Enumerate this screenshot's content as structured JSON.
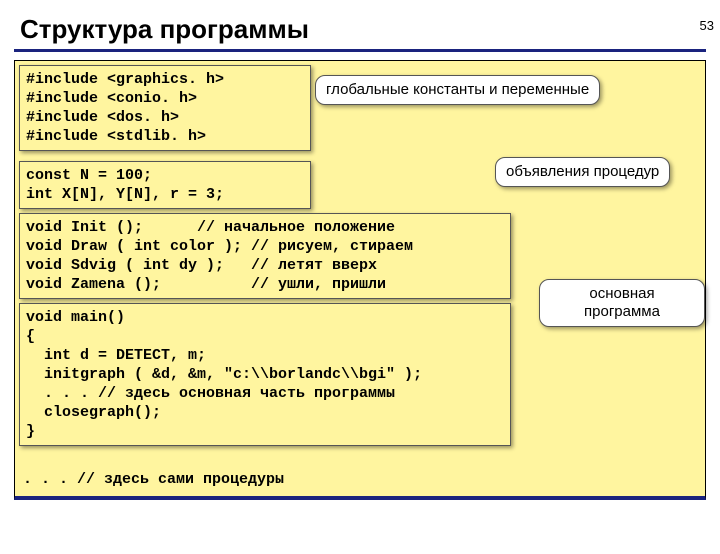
{
  "pageNumber": "53",
  "title": "Структура программы",
  "code": {
    "includes": "#include <graphics. h>\n#include <conio. h>\n#include <dos. h>\n#include <stdlib. h>",
    "globals": "const N = 100;\nint X[N], Y[N], r = 3;",
    "protos": "void Init ();      // начальное положение\nvoid Draw ( int color ); // рисуем, стираем\nvoid Sdvig ( int dy );   // летят вверх\nvoid Zamena ();          // ушли, пришли",
    "main": "void main()\n{\n  int d = DETECT, m;\n  initgraph ( &d, &m, \"c:\\\\borlandc\\\\bgi\" );\n  . . . // здесь основная часть программы\n  closegraph();\n}",
    "bottom": ". . . // здесь сами процедуры"
  },
  "callouts": {
    "globals": "глобальные\nконстанты и\nпеременные",
    "decls": "объявления\nпроцедур",
    "main": "основная\nпрограмма"
  }
}
